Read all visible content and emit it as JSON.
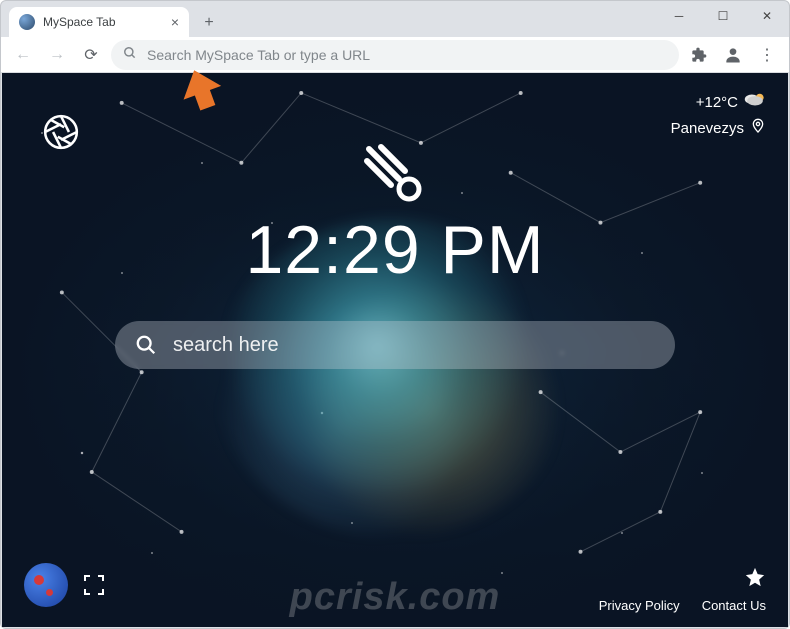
{
  "tab": {
    "title": "MySpace Tab"
  },
  "omnibox": {
    "placeholder": "Search MySpace Tab or type a URL"
  },
  "weather": {
    "temperature": "+12°C",
    "location": "Panevezys"
  },
  "clock": {
    "time": "12:29 PM"
  },
  "search": {
    "placeholder": "search here"
  },
  "footer": {
    "privacy": "Privacy Policy",
    "contact": "Contact Us"
  },
  "watermark": "pcrisk.com"
}
